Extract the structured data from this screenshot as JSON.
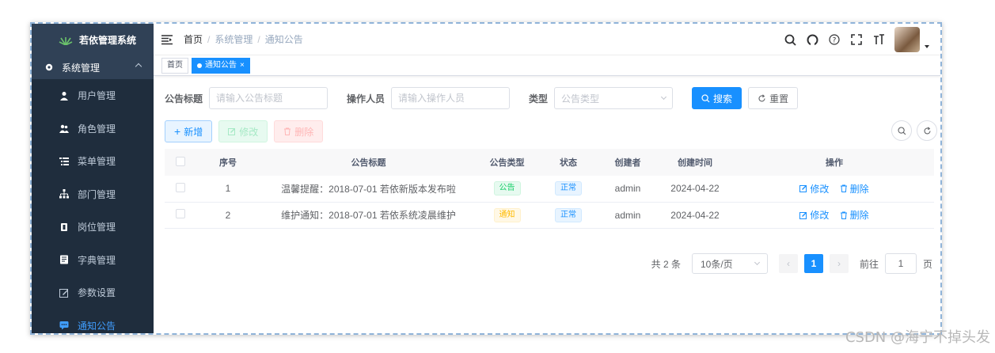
{
  "app": {
    "title": "若依管理系统"
  },
  "sidebar": {
    "parent": {
      "label": "系统管理"
    },
    "items": [
      {
        "label": "用户管理",
        "icon": "user-icon"
      },
      {
        "label": "角色管理",
        "icon": "peoples-icon"
      },
      {
        "label": "菜单管理",
        "icon": "tree-table-icon"
      },
      {
        "label": "部门管理",
        "icon": "tree-icon"
      },
      {
        "label": "岗位管理",
        "icon": "post-icon"
      },
      {
        "label": "字典管理",
        "icon": "dict-icon"
      },
      {
        "label": "参数设置",
        "icon": "edit-icon"
      },
      {
        "label": "通知公告",
        "icon": "message-icon",
        "active": true
      }
    ]
  },
  "breadcrumb": [
    "首页",
    "系统管理",
    "通知公告"
  ],
  "tags": [
    {
      "label": "首页"
    },
    {
      "label": "通知公告",
      "close": "×"
    }
  ],
  "search": {
    "title_label": "公告标题",
    "title_placeholder": "请输入公告标题",
    "operator_label": "操作人员",
    "operator_placeholder": "请输入操作人员",
    "type_label": "类型",
    "type_placeholder": "公告类型",
    "search_btn": "搜索",
    "reset_btn": "重置"
  },
  "toolbar": {
    "add": "新增",
    "edit": "修改",
    "delete": "删除"
  },
  "table": {
    "headers": [
      "序号",
      "公告标题",
      "公告类型",
      "状态",
      "创建者",
      "创建时间",
      "操作"
    ],
    "rows": [
      {
        "id": "1",
        "title": "温馨提醒：2018-07-01 若依新版本发布啦",
        "type": "公告",
        "status": "正常",
        "creator": "admin",
        "time": "2024-04-22"
      },
      {
        "id": "2",
        "title": "维护通知：2018-07-01 若依系统凌晨维护",
        "type": "通知",
        "status": "正常",
        "creator": "admin",
        "time": "2024-04-22"
      }
    ],
    "op_edit": "修改",
    "op_delete": "删除"
  },
  "pagination": {
    "total": "共 2 条",
    "page_size": "10条/页",
    "prev": "‹",
    "current": "1",
    "next": "›",
    "goto_label": "前往",
    "goto_value": "1",
    "page_unit": "页"
  },
  "watermark": "CSDN @海宁不掉头发",
  "colors": {
    "sidebar": "#304156",
    "submenu": "#1f2d3d",
    "primary": "#1890ff"
  }
}
